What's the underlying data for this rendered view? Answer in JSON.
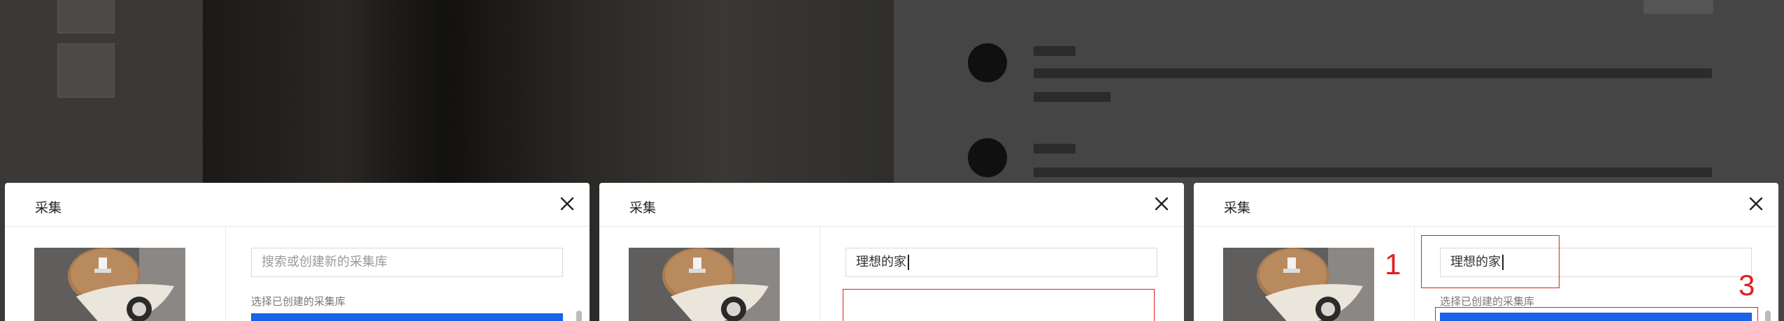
{
  "modals": [
    {
      "title": "采集",
      "search_placeholder": "搜索或创建新的采集库",
      "search_value": "",
      "list_label": "选择已创建的采集库"
    },
    {
      "title": "采集",
      "search_placeholder": "",
      "search_value": "理想的家"
    },
    {
      "title": "采集",
      "search_placeholder": "",
      "search_value": "理想的家",
      "list_label": "选择已创建的采集库"
    }
  ],
  "annotations": {
    "step1": "1",
    "step3": "3"
  },
  "colors": {
    "accent": "#1a62e6",
    "annotation": "#e02020"
  },
  "icons": {
    "close": "close-icon"
  }
}
